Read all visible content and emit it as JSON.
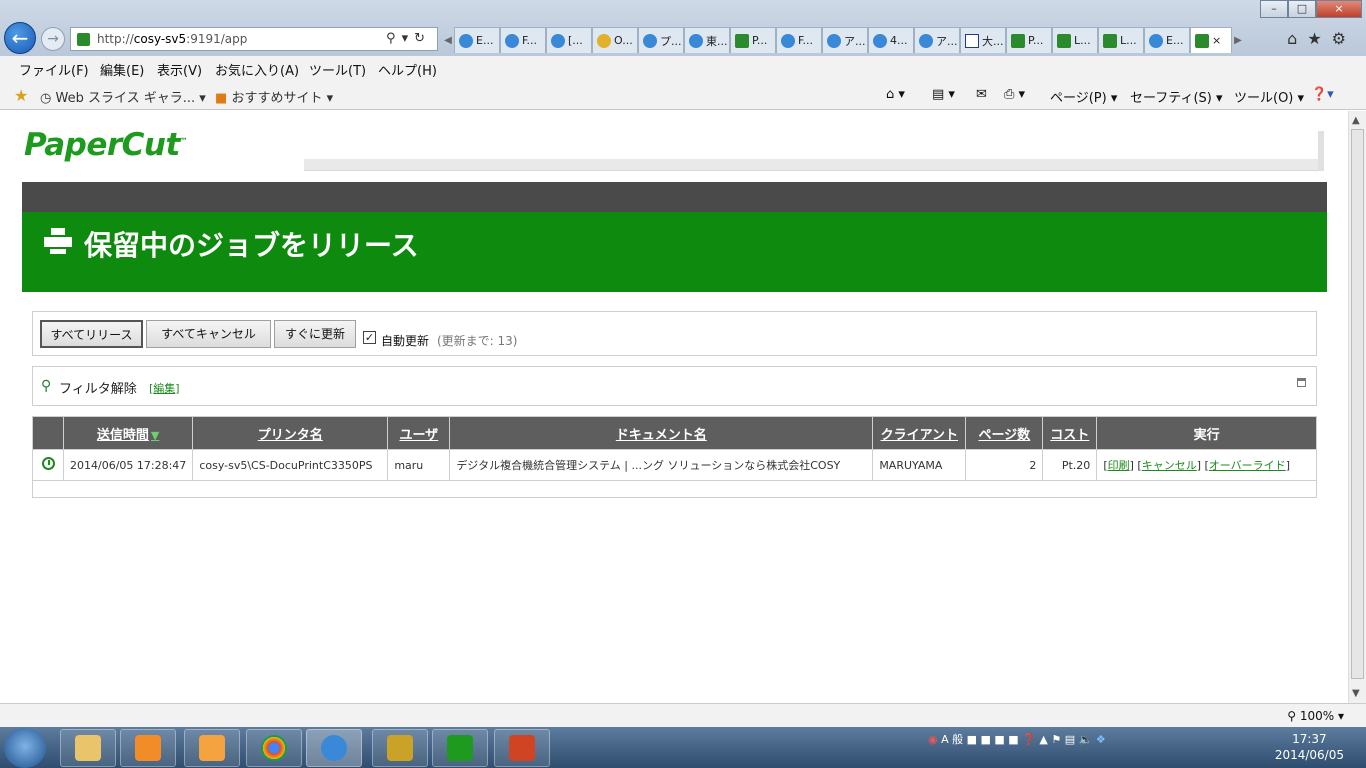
{
  "browser": {
    "url_prefix": "http://",
    "url_host": "cosy-sv5",
    "url_rest": ":9191/app",
    "tabs": [
      "E...",
      "F...",
      "[...",
      "O...",
      "プ...",
      "東...",
      "P...",
      "F...",
      "ア...",
      "4...",
      "ア...",
      "大...",
      "P...",
      "L...",
      "L...",
      "E..."
    ],
    "menu": [
      "ファイル(F)",
      "編集(E)",
      "表示(V)",
      "お気に入り(A)",
      "ツール(T)",
      "ヘルプ(H)"
    ],
    "favorites": [
      "Web スライス ギャラ...",
      "おすすめサイト"
    ],
    "commands": [
      "ページ(P)",
      "セーフティ(S)",
      "ツール(O)"
    ],
    "zoom": "100%"
  },
  "app": {
    "logo": "PaperCut",
    "logo_tm": "™",
    "page_title": "保留中のジョブをリリース",
    "toolbar": {
      "release_all": "すべてリリース",
      "cancel_all": "すべてキャンセル",
      "refresh_now": "すぐに更新",
      "auto_refresh_label": "自動更新",
      "auto_refresh_note": "(更新まで: 13)"
    },
    "filter": {
      "label": "フィルタ解除",
      "edit_link": "編集"
    },
    "table": {
      "headers": {
        "submit_time": "送信時間",
        "printer": "プリンタ名",
        "user": "ユーザ",
        "document": "ドキュメント名",
        "client": "クライアント",
        "pages": "ページ数",
        "cost": "コスト",
        "action": "実行"
      },
      "rows": [
        {
          "submit_time": "2014/06/05 17:28:47",
          "printer": "cosy-sv5\\CS-DocuPrintC3350PS",
          "user": "maru",
          "document": "デジタル複合機統合管理システム | ...ング ソリューションなら株式会社COSY",
          "client": "MARUYAMA",
          "pages": "2",
          "cost": "Pt.20",
          "action_print": "印刷",
          "action_cancel": "キャンセル",
          "action_override": "オーバーライド"
        }
      ]
    }
  },
  "taskbar": {
    "time": "17:37",
    "date": "2014/06/05",
    "tray_text": "A 般"
  },
  "colors": {
    "brand_green": "#0e8a0e",
    "header_dark": "#4a4a4a",
    "table_header": "#5e5e5e"
  }
}
